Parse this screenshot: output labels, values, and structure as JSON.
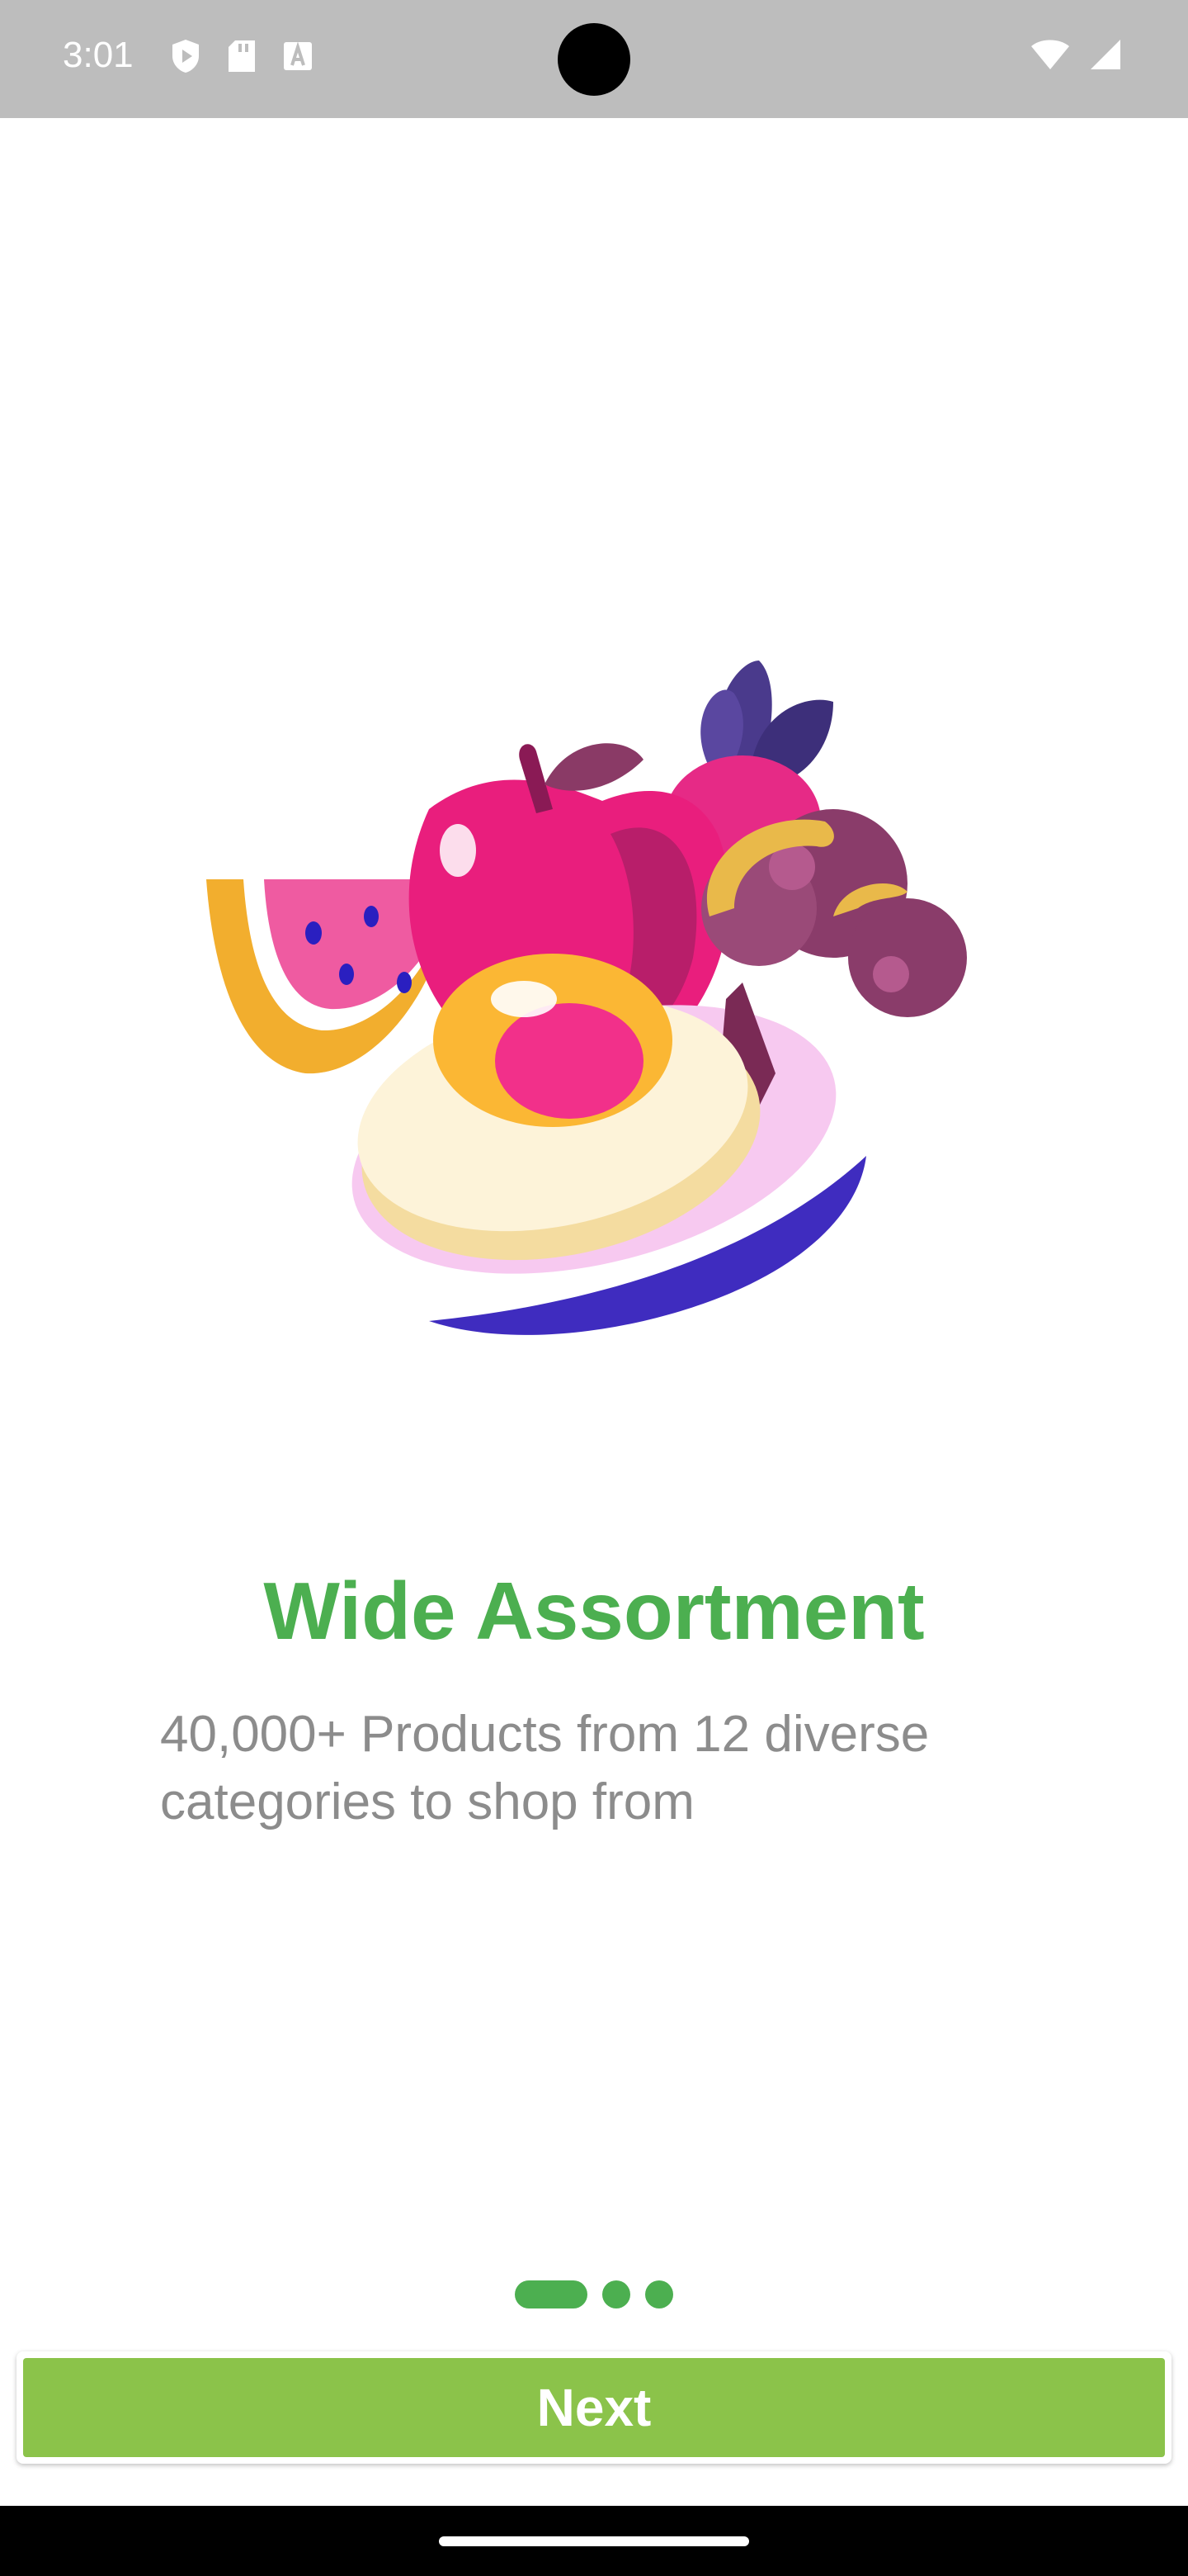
{
  "status_bar": {
    "time": "3:01",
    "left_icons": [
      "shield-play-icon",
      "sd-card-icon",
      "keyboard-a-icon"
    ],
    "right_icons": [
      "wifi-icon",
      "cell-signal-icon"
    ]
  },
  "onboarding": {
    "illustration": "groceries-fruit-egg-illustration",
    "title": "Wide Assortment",
    "subtitle": "40,000+ Products from 12 diverse categories to shop from",
    "pager": {
      "total": 3,
      "current": 1
    },
    "next_label": "Next"
  },
  "colors": {
    "title": "#4caf50",
    "button": "#8bc34a",
    "subtitle": "#8c8c8c",
    "status_bar": "#bdbdbd"
  }
}
